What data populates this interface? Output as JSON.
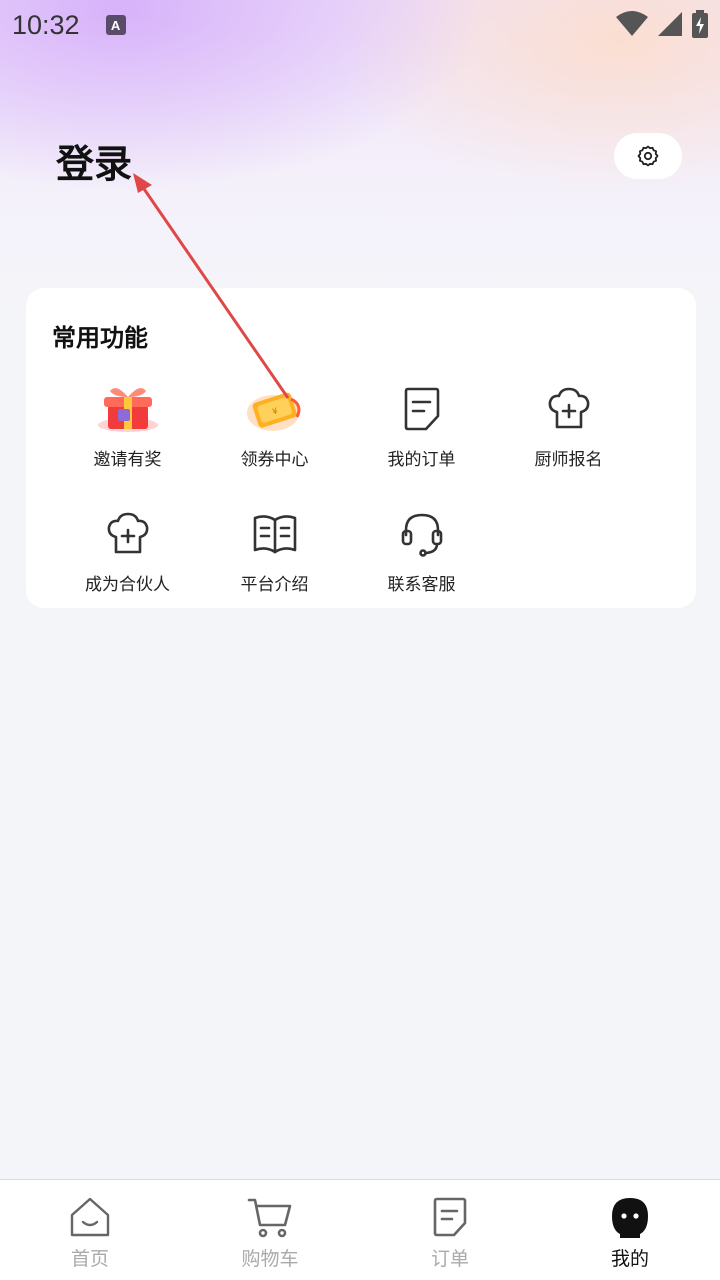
{
  "status_bar": {
    "time": "10:32",
    "notification_badge": "A"
  },
  "header": {
    "login_label": "登录"
  },
  "common_functions": {
    "title": "常用功能",
    "items": [
      {
        "label": "邀请有奖",
        "icon": "gift-box-icon"
      },
      {
        "label": "领券中心",
        "icon": "coupon-icon"
      },
      {
        "label": "我的订单",
        "icon": "document-icon"
      },
      {
        "label": "厨师报名",
        "icon": "chef-hat-icon"
      },
      {
        "label": "成为合伙人",
        "icon": "chef-hat-icon"
      },
      {
        "label": "平台介绍",
        "icon": "book-icon"
      },
      {
        "label": "联系客服",
        "icon": "headset-icon"
      }
    ]
  },
  "tabbar": {
    "items": [
      {
        "label": "首页",
        "icon": "home-icon",
        "active": false
      },
      {
        "label": "购物车",
        "icon": "cart-icon",
        "active": false
      },
      {
        "label": "订单",
        "icon": "order-icon",
        "active": false
      },
      {
        "label": "我的",
        "icon": "profile-icon",
        "active": true
      }
    ]
  },
  "colors": {
    "arrow": "#e04848",
    "active_tab": "#111111",
    "inactive_tab": "#aaaaaa"
  }
}
